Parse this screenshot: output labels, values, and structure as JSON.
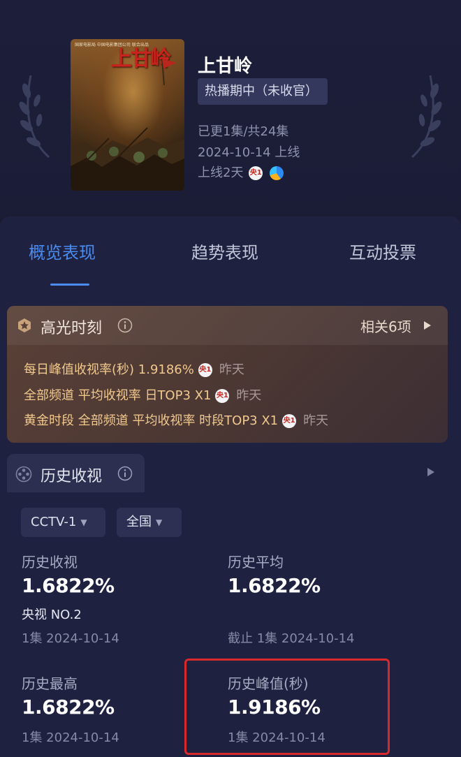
{
  "show": {
    "title": "上甘岭",
    "status": "热播期中（未收官）",
    "episodes": "已更1集/共24集",
    "release": "2024-10-14 上线",
    "days_online": "上线2天",
    "poster": {
      "title": "上甘岭",
      "tagline": "国家电影局 中国电影集团公司 联合出品"
    },
    "channel_icon_text": "央1"
  },
  "tabs": [
    {
      "label": "概览表现",
      "active": true
    },
    {
      "label": "趋势表现",
      "active": false
    },
    {
      "label": "互动投票",
      "active": false
    }
  ],
  "highlights": {
    "title": "高光时刻",
    "related": "相关6项",
    "rows": [
      {
        "text": "每日峰值收视率(秒)  1.9186%",
        "channel": "央1",
        "when": "昨天"
      },
      {
        "text": "全部频道 平均收视率  日TOP3 X1",
        "channel": "央1",
        "when": "昨天"
      },
      {
        "text": "黄金时段 全部频道 平均收视率  时段TOP3 X1",
        "channel": "央1",
        "when": "昨天"
      }
    ]
  },
  "history": {
    "title": "历史收视",
    "channel_select": "CCTV-1",
    "region_select": "全国",
    "stats": [
      {
        "label": "历史收视",
        "value": "1.6822%",
        "sub": "央视 NO.2",
        "date": "1集 2024-10-14"
      },
      {
        "label": "历史平均",
        "value": "1.6822%",
        "sub": "",
        "date": "截止 1集 2024-10-14"
      },
      {
        "label": "历史最高",
        "value": "1.6822%",
        "sub": "",
        "date": "1集 2024-10-14"
      },
      {
        "label": "历史峰值(秒)",
        "value": "1.9186%",
        "sub": "",
        "date": "1集 2024-10-14"
      }
    ]
  },
  "colors": {
    "background": "#1b1c33",
    "accent": "#4a8cf0",
    "highlight_text": "#f1c98e",
    "annotation_red": "#d82a2a"
  }
}
